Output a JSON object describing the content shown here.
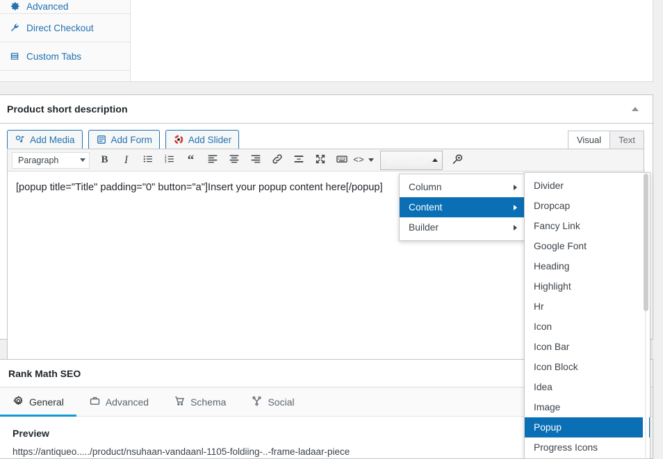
{
  "product_data_tabs": [
    {
      "label": "Advanced",
      "icon": "gear-icon"
    },
    {
      "label": "Direct Checkout",
      "icon": "wrench-icon"
    },
    {
      "label": "Custom Tabs",
      "icon": "table-icon"
    }
  ],
  "short_description": {
    "title": "Product short description",
    "collapse_icon": "caret-up-icon",
    "media_buttons": [
      {
        "label": "Add Media",
        "icon": "media-icon"
      },
      {
        "label": "Add Form",
        "icon": "form-icon"
      },
      {
        "label": "Add Slider",
        "icon": "slider-icon"
      }
    ],
    "editor_tabs": [
      {
        "label": "Visual",
        "active": true
      },
      {
        "label": "Text",
        "active": false
      }
    ],
    "toolbar": {
      "format_select": "Paragraph",
      "bold": "B",
      "italic": "I",
      "bulleted_list": "bullist-icon",
      "numbered_list": "numlist-icon",
      "blockquote": "“",
      "align_left": "alignleft-icon",
      "align_center": "aligncenter-icon",
      "align_right": "alignright-icon",
      "link": "link-icon",
      "read_more": "readmore-icon",
      "fullscreen": "fullscreen-icon",
      "toolbar_toggle": "keyboard-icon",
      "source_code": "<>",
      "source_caret": "caret-down-icon",
      "shortcode_label": "Shortcode",
      "shortcode_caret": "caret-up-icon",
      "search": "magnifier-icon"
    },
    "content": "[popup title=\"Title\" padding=\"0\" button=\"a\"]Insert your popup content here[/popup]"
  },
  "shortcode_menu": {
    "items": [
      {
        "label": "Column",
        "active": false,
        "has_submenu": true
      },
      {
        "label": "Content",
        "active": true,
        "has_submenu": true
      },
      {
        "label": "Builder",
        "active": false,
        "has_submenu": true
      }
    ]
  },
  "shortcode_submenu": {
    "items": [
      {
        "label": "Divider",
        "active": false
      },
      {
        "label": "Dropcap",
        "active": false
      },
      {
        "label": "Fancy Link",
        "active": false
      },
      {
        "label": "Google Font",
        "active": false
      },
      {
        "label": "Heading",
        "active": false
      },
      {
        "label": "Highlight",
        "active": false
      },
      {
        "label": "Hr",
        "active": false
      },
      {
        "label": "Icon",
        "active": false
      },
      {
        "label": "Icon Bar",
        "active": false
      },
      {
        "label": "Icon Block",
        "active": false
      },
      {
        "label": "Idea",
        "active": false
      },
      {
        "label": "Image",
        "active": false
      },
      {
        "label": "Popup",
        "active": true
      },
      {
        "label": "Progress Icons",
        "active": false
      }
    ]
  },
  "rank_math": {
    "title": "Rank Math SEO",
    "tabs": [
      {
        "label": "General",
        "icon": "gear-icon",
        "active": true
      },
      {
        "label": "Advanced",
        "icon": "briefcase-icon",
        "active": false
      },
      {
        "label": "Schema",
        "icon": "cart-icon",
        "active": false
      },
      {
        "label": "Social",
        "icon": "share-icon",
        "active": false
      }
    ],
    "preview_label": "Preview",
    "preview_url": "https://antiqueo...../product/nsuhaan-vandaanl-1105-foldiing-..-frame-ladaar-piece"
  },
  "colors": {
    "accent_blue": "#2271b1",
    "menu_highlight": "#0b6fb5",
    "rankmath_underline": "#0d9ad8",
    "panel_border": "#c3c4c7",
    "page_bg": "#f0f0f1"
  }
}
